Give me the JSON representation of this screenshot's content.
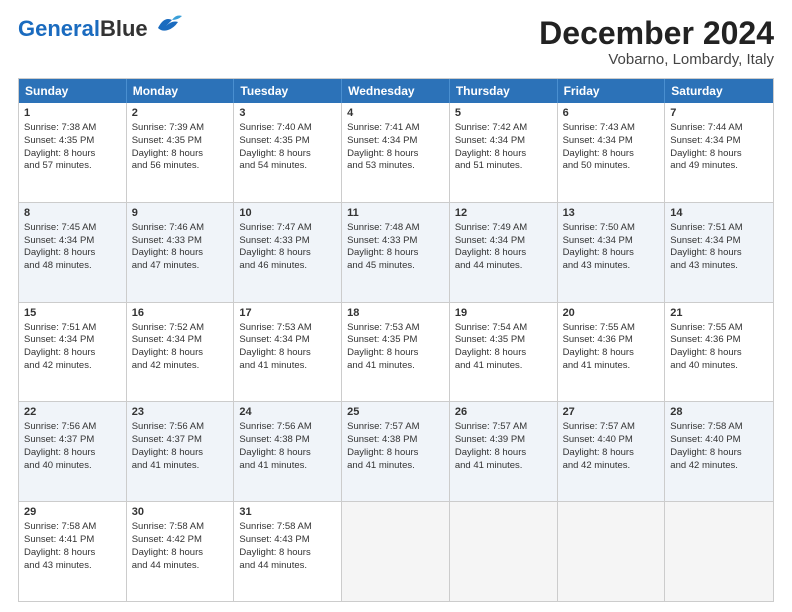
{
  "header": {
    "logo_general": "General",
    "logo_blue": "Blue",
    "month_title": "December 2024",
    "location": "Vobarno, Lombardy, Italy"
  },
  "days_of_week": [
    "Sunday",
    "Monday",
    "Tuesday",
    "Wednesday",
    "Thursday",
    "Friday",
    "Saturday"
  ],
  "weeks": [
    [
      {
        "day": "1",
        "info": "Sunrise: 7:38 AM\nSunset: 4:35 PM\nDaylight: 8 hours\nand 57 minutes."
      },
      {
        "day": "2",
        "info": "Sunrise: 7:39 AM\nSunset: 4:35 PM\nDaylight: 8 hours\nand 56 minutes."
      },
      {
        "day": "3",
        "info": "Sunrise: 7:40 AM\nSunset: 4:35 PM\nDaylight: 8 hours\nand 54 minutes."
      },
      {
        "day": "4",
        "info": "Sunrise: 7:41 AM\nSunset: 4:34 PM\nDaylight: 8 hours\nand 53 minutes."
      },
      {
        "day": "5",
        "info": "Sunrise: 7:42 AM\nSunset: 4:34 PM\nDaylight: 8 hours\nand 51 minutes."
      },
      {
        "day": "6",
        "info": "Sunrise: 7:43 AM\nSunset: 4:34 PM\nDaylight: 8 hours\nand 50 minutes."
      },
      {
        "day": "7",
        "info": "Sunrise: 7:44 AM\nSunset: 4:34 PM\nDaylight: 8 hours\nand 49 minutes."
      }
    ],
    [
      {
        "day": "8",
        "info": "Sunrise: 7:45 AM\nSunset: 4:34 PM\nDaylight: 8 hours\nand 48 minutes."
      },
      {
        "day": "9",
        "info": "Sunrise: 7:46 AM\nSunset: 4:33 PM\nDaylight: 8 hours\nand 47 minutes."
      },
      {
        "day": "10",
        "info": "Sunrise: 7:47 AM\nSunset: 4:33 PM\nDaylight: 8 hours\nand 46 minutes."
      },
      {
        "day": "11",
        "info": "Sunrise: 7:48 AM\nSunset: 4:33 PM\nDaylight: 8 hours\nand 45 minutes."
      },
      {
        "day": "12",
        "info": "Sunrise: 7:49 AM\nSunset: 4:34 PM\nDaylight: 8 hours\nand 44 minutes."
      },
      {
        "day": "13",
        "info": "Sunrise: 7:50 AM\nSunset: 4:34 PM\nDaylight: 8 hours\nand 43 minutes."
      },
      {
        "day": "14",
        "info": "Sunrise: 7:51 AM\nSunset: 4:34 PM\nDaylight: 8 hours\nand 43 minutes."
      }
    ],
    [
      {
        "day": "15",
        "info": "Sunrise: 7:51 AM\nSunset: 4:34 PM\nDaylight: 8 hours\nand 42 minutes."
      },
      {
        "day": "16",
        "info": "Sunrise: 7:52 AM\nSunset: 4:34 PM\nDaylight: 8 hours\nand 42 minutes."
      },
      {
        "day": "17",
        "info": "Sunrise: 7:53 AM\nSunset: 4:34 PM\nDaylight: 8 hours\nand 41 minutes."
      },
      {
        "day": "18",
        "info": "Sunrise: 7:53 AM\nSunset: 4:35 PM\nDaylight: 8 hours\nand 41 minutes."
      },
      {
        "day": "19",
        "info": "Sunrise: 7:54 AM\nSunset: 4:35 PM\nDaylight: 8 hours\nand 41 minutes."
      },
      {
        "day": "20",
        "info": "Sunrise: 7:55 AM\nSunset: 4:36 PM\nDaylight: 8 hours\nand 41 minutes."
      },
      {
        "day": "21",
        "info": "Sunrise: 7:55 AM\nSunset: 4:36 PM\nDaylight: 8 hours\nand 40 minutes."
      }
    ],
    [
      {
        "day": "22",
        "info": "Sunrise: 7:56 AM\nSunset: 4:37 PM\nDaylight: 8 hours\nand 40 minutes."
      },
      {
        "day": "23",
        "info": "Sunrise: 7:56 AM\nSunset: 4:37 PM\nDaylight: 8 hours\nand 41 minutes."
      },
      {
        "day": "24",
        "info": "Sunrise: 7:56 AM\nSunset: 4:38 PM\nDaylight: 8 hours\nand 41 minutes."
      },
      {
        "day": "25",
        "info": "Sunrise: 7:57 AM\nSunset: 4:38 PM\nDaylight: 8 hours\nand 41 minutes."
      },
      {
        "day": "26",
        "info": "Sunrise: 7:57 AM\nSunset: 4:39 PM\nDaylight: 8 hours\nand 41 minutes."
      },
      {
        "day": "27",
        "info": "Sunrise: 7:57 AM\nSunset: 4:40 PM\nDaylight: 8 hours\nand 42 minutes."
      },
      {
        "day": "28",
        "info": "Sunrise: 7:58 AM\nSunset: 4:40 PM\nDaylight: 8 hours\nand 42 minutes."
      }
    ],
    [
      {
        "day": "29",
        "info": "Sunrise: 7:58 AM\nSunset: 4:41 PM\nDaylight: 8 hours\nand 43 minutes."
      },
      {
        "day": "30",
        "info": "Sunrise: 7:58 AM\nSunset: 4:42 PM\nDaylight: 8 hours\nand 44 minutes."
      },
      {
        "day": "31",
        "info": "Sunrise: 7:58 AM\nSunset: 4:43 PM\nDaylight: 8 hours\nand 44 minutes."
      },
      {
        "day": "",
        "info": ""
      },
      {
        "day": "",
        "info": ""
      },
      {
        "day": "",
        "info": ""
      },
      {
        "day": "",
        "info": ""
      }
    ]
  ]
}
